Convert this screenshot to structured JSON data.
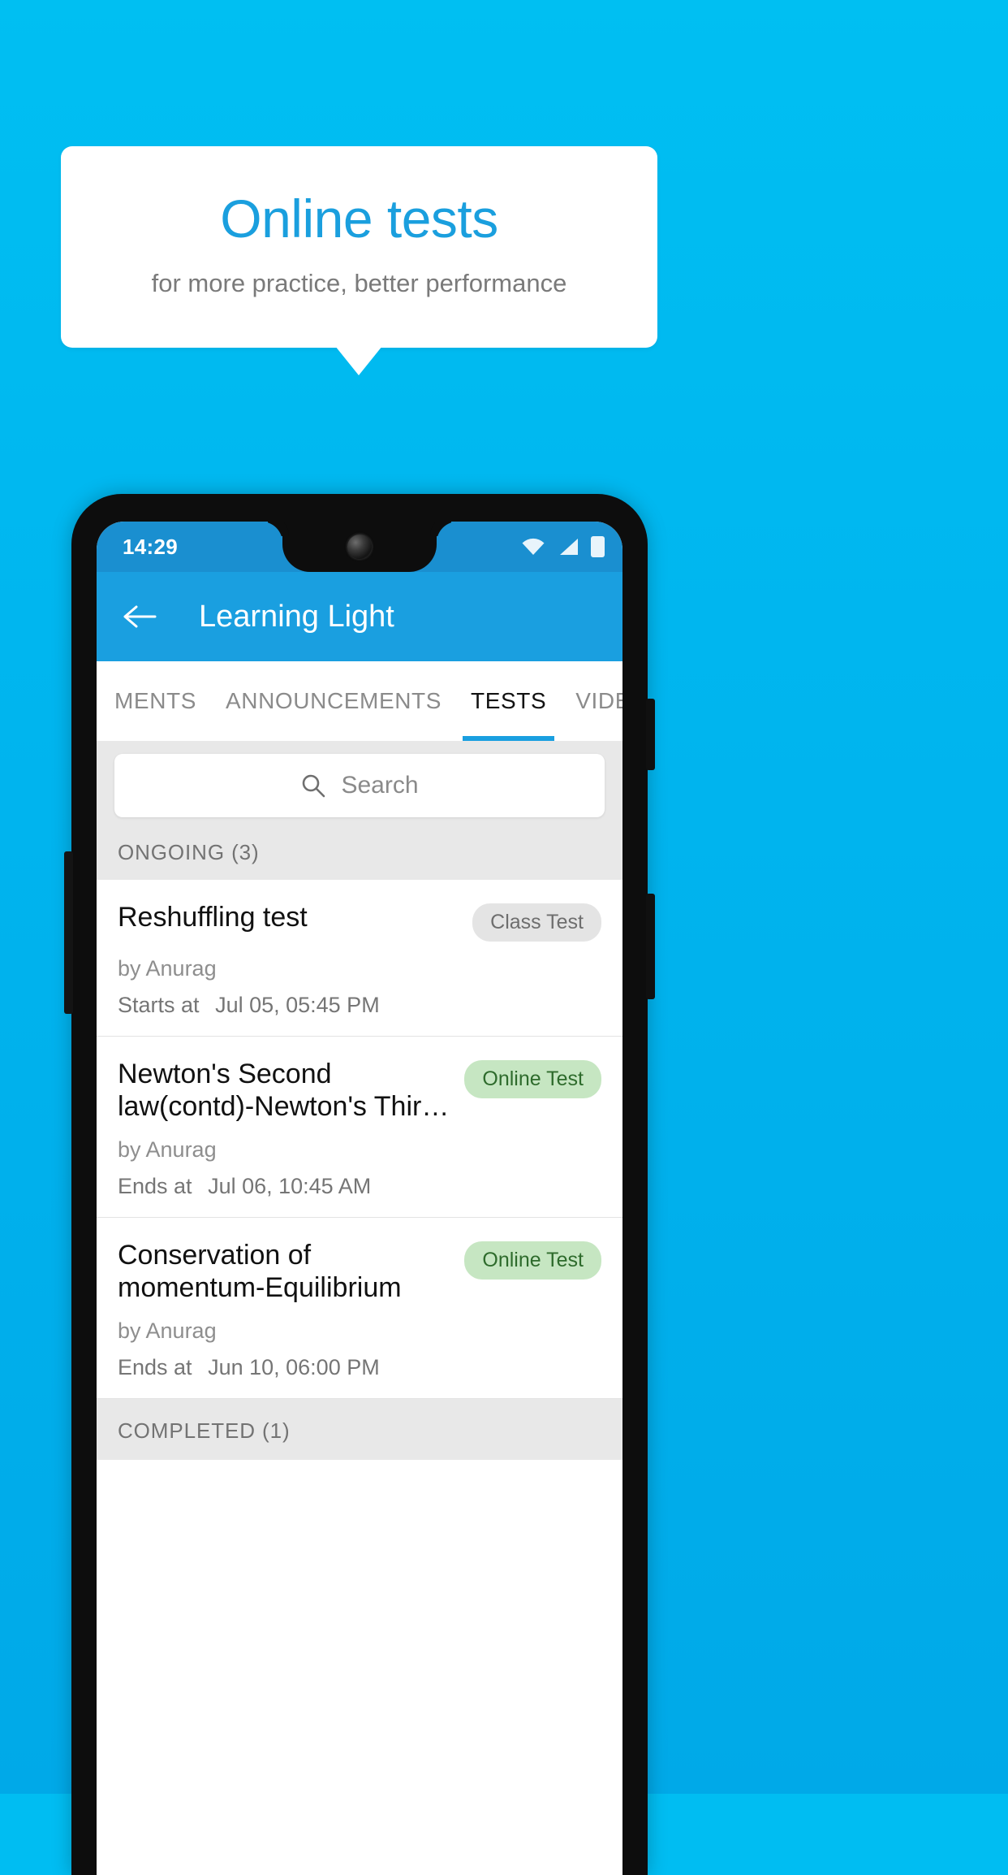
{
  "promo": {
    "title": "Online tests",
    "subtitle": "for more practice, better performance",
    "accent_color": "#1a9fde",
    "background_color": "#00bdf2"
  },
  "phone": {
    "statusbar": {
      "time": "14:29",
      "icons": [
        "wifi-icon",
        "cellular-signal-icon",
        "battery-icon"
      ]
    },
    "appbar": {
      "back_label": "back-arrow-icon",
      "title": "Learning Light"
    },
    "tabs": [
      {
        "label": "MENTS",
        "active": false
      },
      {
        "label": "ANNOUNCEMENTS",
        "active": false
      },
      {
        "label": "TESTS",
        "active": true
      },
      {
        "label": "VIDEOS",
        "active": false
      }
    ],
    "search": {
      "placeholder": "Search",
      "value": "",
      "icon": "search-icon"
    },
    "sections": [
      {
        "header": "ONGOING (3)",
        "items": [
          {
            "title": "Reshuffling test",
            "badge": "Class Test",
            "badge_type": "class",
            "author": "by Anurag",
            "time_label": "Starts at",
            "time_value": "Jul 05, 05:45 PM"
          },
          {
            "title": "Newton's Second law(contd)-Newton's Thir…",
            "badge": "Online Test",
            "badge_type": "online",
            "author": "by Anurag",
            "time_label": "Ends at",
            "time_value": "Jul 06, 10:45 AM"
          },
          {
            "title": "Conservation of momentum-Equilibrium",
            "badge": "Online Test",
            "badge_type": "online",
            "author": "by Anurag",
            "time_label": "Ends at",
            "time_value": "Jun 10, 06:00 PM"
          }
        ]
      },
      {
        "header": "COMPLETED (1)",
        "items": []
      }
    ]
  }
}
